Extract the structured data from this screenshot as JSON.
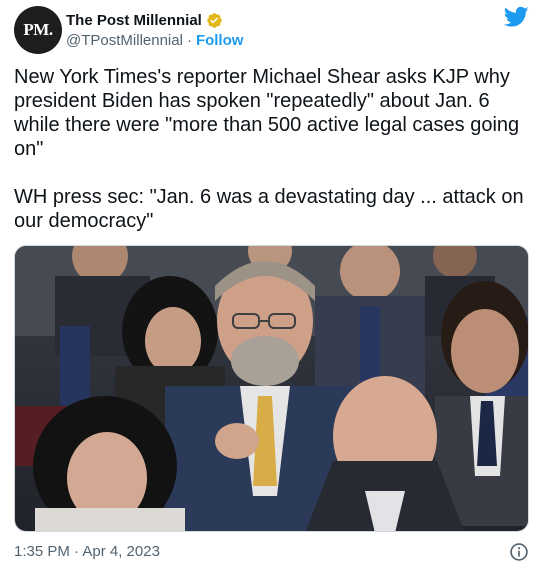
{
  "account": {
    "avatar_text": "PM.",
    "display_name": "The Post Millennial",
    "handle": "@TPostMillennial",
    "separator": "·",
    "follow_label": "Follow",
    "verified_color": "#e2b719"
  },
  "tweet": {
    "text": "New York Times's reporter Michael Shear asks KJP why president Biden has spoken \"repeatedly\" about Jan. 6 while there were \"more than 500 active legal cases going on\"\n\nWH press sec: \"Jan. 6 was a devastating day ... attack on our democracy\""
  },
  "media": {
    "type": "photo"
  },
  "footer": {
    "timestamp": "1:35 PM · Apr 4, 2023"
  },
  "icons": {
    "brand": "twitter-bird-icon",
    "badge": "verified-badge-icon",
    "info": "info-icon"
  },
  "colors": {
    "accent": "#1d9bf0",
    "secondary_text": "#536471",
    "primary_text": "#0f1419"
  }
}
